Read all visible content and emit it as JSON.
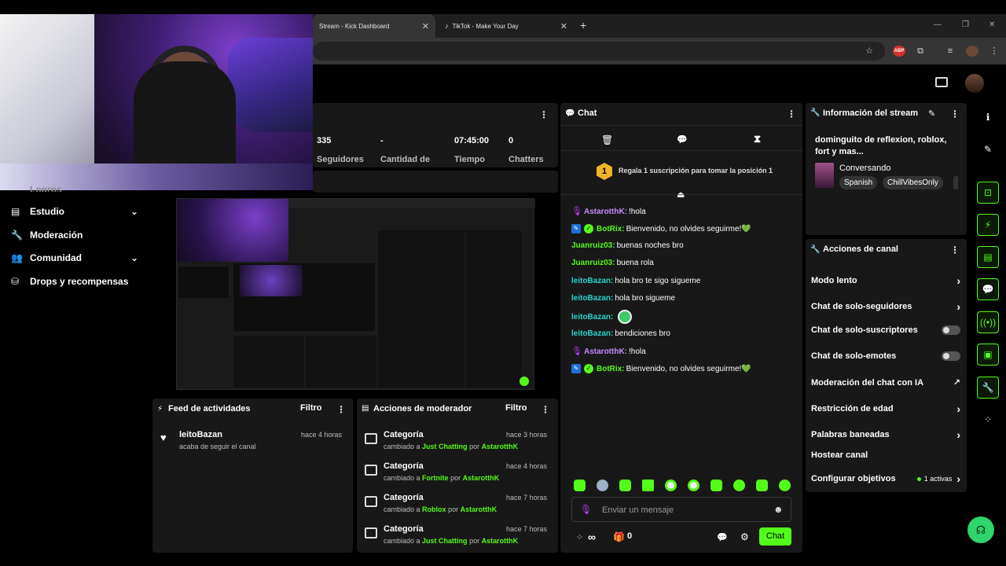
{
  "browser": {
    "tabs": [
      {
        "label": "Stream - Kick Dashboard"
      },
      {
        "label": "TikTok - Make Your Day"
      }
    ],
    "new_tab": "+",
    "ext_badge": "ABP"
  },
  "stats": {
    "items": [
      {
        "value": "335",
        "label": "Seguidores"
      },
      {
        "value": "-",
        "label": "Cantidad de"
      },
      {
        "value": "07:45:00",
        "label": "Tiempo"
      },
      {
        "value": "0",
        "label": "Chatters"
      }
    ]
  },
  "sidebar": {
    "partial_top": "Logros",
    "items": [
      {
        "label": "Estudio",
        "icon": "studio-icon",
        "chevron": true
      },
      {
        "label": "Moderación",
        "icon": "wrench-icon",
        "chevron": false
      },
      {
        "label": "Comunidad",
        "icon": "community-icon",
        "chevron": true
      },
      {
        "label": "Drops y recompensas",
        "icon": "drops-icon",
        "chevron": false
      }
    ]
  },
  "chat": {
    "title": "Chat",
    "sub_gift_rank": "1",
    "sub_gift_text": "Regala 1 suscripción para tomar la posición 1",
    "messages": [
      {
        "user": "AstarotthK:",
        "text": "!hola",
        "color": "#53fc18",
        "badge": "mic"
      },
      {
        "user": "BotRix:",
        "text": "Bienvenido, no olvides seguirme!💚",
        "color": "#53fc18",
        "badge": "bot"
      },
      {
        "user": "Juanruiz03:",
        "text": "buenas noches bro",
        "color": "#53fc18",
        "badge": ""
      },
      {
        "user": "Juanruiz03:",
        "text": "buena rola",
        "color": "#53fc18",
        "badge": ""
      },
      {
        "user": "leitoBazan:",
        "text": "hola bro te sigo sigueme",
        "color": "#2ad3c8",
        "badge": ""
      },
      {
        "user": "leitoBazan:",
        "text": "hola bro sigueme",
        "color": "#2ad3c8",
        "badge": ""
      },
      {
        "user": "leitoBazan:",
        "text": "",
        "color": "#2ad3c8",
        "badge": "",
        "emote": true
      },
      {
        "user": "leitoBazan:",
        "text": "bendiciones bro",
        "color": "#2ad3c8",
        "badge": ""
      },
      {
        "user": "AstarotthK:",
        "text": "!hola",
        "color": "#53fc18",
        "badge": "mic"
      },
      {
        "user": "BotRix:",
        "text": "Bienvenido, no olvides seguirme!💚",
        "color": "#53fc18",
        "badge": "bot"
      }
    ],
    "input_placeholder": "Enviar un mensaje",
    "points": "∞",
    "gift_count": "0",
    "send_label": "Chat"
  },
  "stream_info": {
    "title": "Información del stream",
    "stream_title": "dominguito de reflexion, roblox, fort y mas...",
    "category": "Conversando",
    "tags": [
      "Spanish",
      "ChillVibesOnly"
    ]
  },
  "channel_actions": {
    "title": "Acciones de canal",
    "items": [
      {
        "label": "Modo lento",
        "control": "chevron"
      },
      {
        "label": "Chat de solo-seguidores",
        "control": "chevron"
      },
      {
        "label": "Chat de solo-suscriptores",
        "control": "toggle"
      },
      {
        "label": "Chat de solo-emotes",
        "control": "toggle"
      },
      {
        "label": "Moderación del chat con IA",
        "control": "external"
      },
      {
        "label": "Restricción de edad",
        "control": "chevron"
      },
      {
        "label": "Palabras baneadas",
        "control": "chevron"
      },
      {
        "label": "Hostear canal",
        "control": "none"
      },
      {
        "label": "Configurar objetivos",
        "control": "chevron",
        "extra": "1 activas"
      }
    ]
  },
  "activity_feed": {
    "title": "Feed de actividades",
    "filter": "Filtro",
    "items": [
      {
        "user": "leitoBazan",
        "action": "acaba de seguir el canal",
        "time": "hace 4 horas"
      }
    ]
  },
  "mod_actions": {
    "title": "Acciones de moderador",
    "filter": "Filtro",
    "items": [
      {
        "title": "Categoría",
        "prefix": "cambiado a",
        "category": "Just Chatting",
        "by": "por",
        "mod": "AstarotthK",
        "time": "hace 3 horas"
      },
      {
        "title": "Categoría",
        "prefix": "cambiado a",
        "category": "Fortnite",
        "by": "por",
        "mod": "AstarotthK",
        "time": "hace 4 horas"
      },
      {
        "title": "Categoría",
        "prefix": "cambiado a",
        "category": "Roblox",
        "by": "por",
        "mod": "AstarotthK",
        "time": "hace 7 horas"
      },
      {
        "title": "Categoría",
        "prefix": "cambiado a",
        "category": "Just Chatting",
        "by": "por",
        "mod": "AstarotthK",
        "time": "hace 7 horas"
      }
    ]
  },
  "colors": {
    "accent": "#53fc18",
    "panel": "#181818",
    "background": "#000000"
  }
}
